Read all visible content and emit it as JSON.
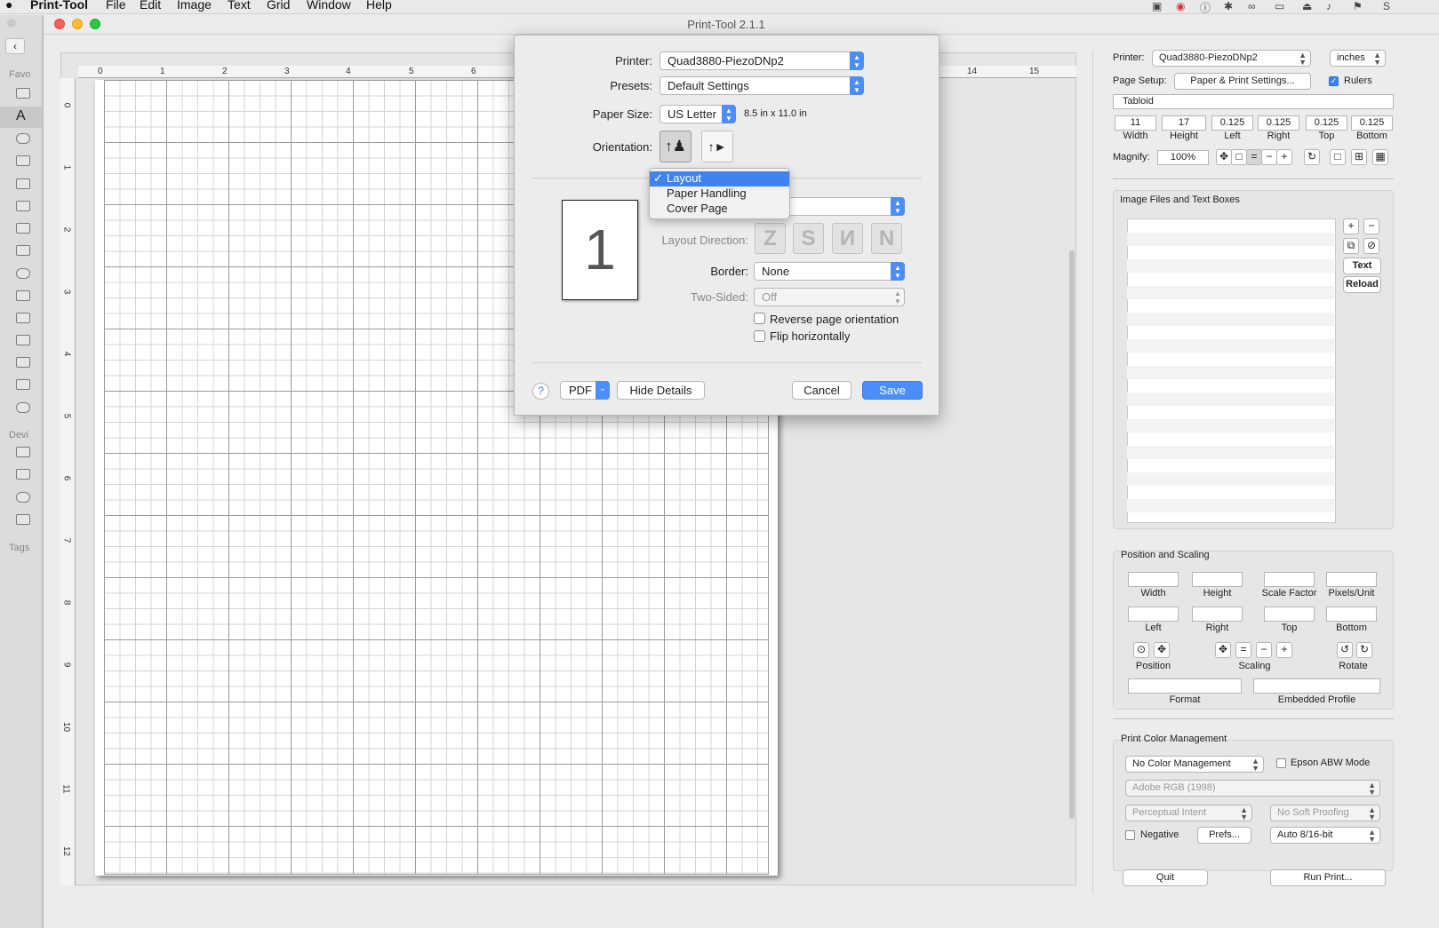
{
  "menubar": {
    "app": "Print-Tool",
    "items": [
      "File",
      "Edit",
      "Image",
      "Text",
      "Grid",
      "Window",
      "Help"
    ],
    "status_right": "S"
  },
  "finder": {
    "favorites_label": "Favo",
    "devices_label": "Devi",
    "tags_label": "Tags"
  },
  "window": {
    "title": "Print-Tool 2.1.1"
  },
  "ruler": {
    "h_numbers": [
      "0",
      "1",
      "2",
      "3",
      "4",
      "5",
      "6",
      "14",
      "15"
    ],
    "v_numbers": [
      "0",
      "1",
      "2",
      "3",
      "4",
      "5",
      "6",
      "7",
      "8",
      "9",
      "10",
      "11",
      "12"
    ]
  },
  "dialog": {
    "printer_label": "Printer:",
    "printer_value": "Quad3880-PiezoDNp2",
    "presets_label": "Presets:",
    "presets_value": "Default Settings",
    "paper_size_label": "Paper Size:",
    "paper_size_value": "US Letter",
    "paper_dims": "8.5 in x 11.0 in",
    "orientation_label": "Orientation:",
    "preview_page": "1",
    "section_menu": {
      "items": [
        "Layout",
        "Paper Handling",
        "Cover Page"
      ],
      "selected": "Layout"
    },
    "layout_direction_label": "Layout Direction:",
    "layout_direction_glyphs": [
      "Z",
      "S",
      "N",
      "N"
    ],
    "border_label": "Border:",
    "border_value": "None",
    "two_sided_label": "Two-Sided:",
    "two_sided_value": "Off",
    "reverse_label": "Reverse page orientation",
    "flip_label": "Flip horizontally",
    "help": "?",
    "pdf_label": "PDF",
    "hide_details": "Hide Details",
    "cancel": "Cancel",
    "save": "Save"
  },
  "panel": {
    "printer_label": "Printer:",
    "printer_value": "Quad3880-PiezoDNp2",
    "units_value": "inches",
    "page_setup_label": "Page Setup:",
    "page_setup_button": "Paper & Print Settings...",
    "rulers_label": "Rulers",
    "paper_name": "Tabloid",
    "dims": [
      {
        "value": "11",
        "label": "Width"
      },
      {
        "value": "17",
        "label": "Height"
      },
      {
        "value": "0.125",
        "label": "Left"
      },
      {
        "value": "0.125",
        "label": "Right"
      },
      {
        "value": "0.125",
        "label": "Top"
      },
      {
        "value": "0.125",
        "label": "Bottom"
      }
    ],
    "magnify_label": "Magnify:",
    "magnify_value": "100%",
    "image_files_title": "Image Files and Text Boxes",
    "text_button": "Text",
    "reload_button": "Reload",
    "position_scaling_title": "Position and Scaling",
    "ps_row1": [
      "Width",
      "Height",
      "Scale Factor",
      "Pixels/Unit"
    ],
    "ps_row2": [
      "Left",
      "Right",
      "Top",
      "Bottom"
    ],
    "position_label": "Position",
    "scaling_label": "Scaling",
    "rotate_label": "Rotate",
    "format_label": "Format",
    "embedded_profile_label": "Embedded Profile",
    "color_mgmt_title": "Print Color Management",
    "color_mgmt_value": "No Color Management",
    "epson_abw_label": "Epson ABW Mode",
    "profile_value": "Adobe RGB (1998)",
    "intent_value": "Perceptual Intent",
    "soft_proof_value": "No Soft Proofing",
    "negative_label": "Negative",
    "prefs_button": "Prefs...",
    "bit_depth_value": "Auto 8/16-bit",
    "quit_button": "Quit",
    "run_print_button": "Run Print..."
  },
  "colors": {
    "accent": "#3f82f0",
    "save_button": "#4b8ef7"
  }
}
